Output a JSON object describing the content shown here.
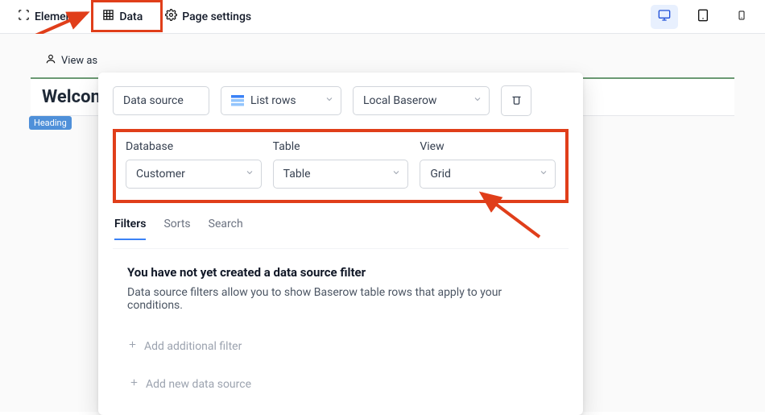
{
  "topbar": {
    "elements_label": "Elements",
    "data_label": "Data",
    "page_settings_label": "Page settings"
  },
  "view_as_label": "View as",
  "welcome_title": "Welcon",
  "heading_tag": "Heading",
  "panel": {
    "data_source_label": "Data source",
    "service_label": "List rows",
    "integration_label": "Local Baserow",
    "database_label": "Database",
    "table_label": "Table",
    "view_label": "View",
    "database_value": "Customer",
    "table_value": "Table",
    "view_value": "Grid",
    "tabs": {
      "filters": "Filters",
      "sorts": "Sorts",
      "search": "Search"
    },
    "empty_title": "You have not yet created a data source filter",
    "empty_desc": "Data source filters allow you to show Baserow table rows that apply to your conditions.",
    "add_filter": "Add additional filter",
    "add_data_source": "Add new data source"
  }
}
